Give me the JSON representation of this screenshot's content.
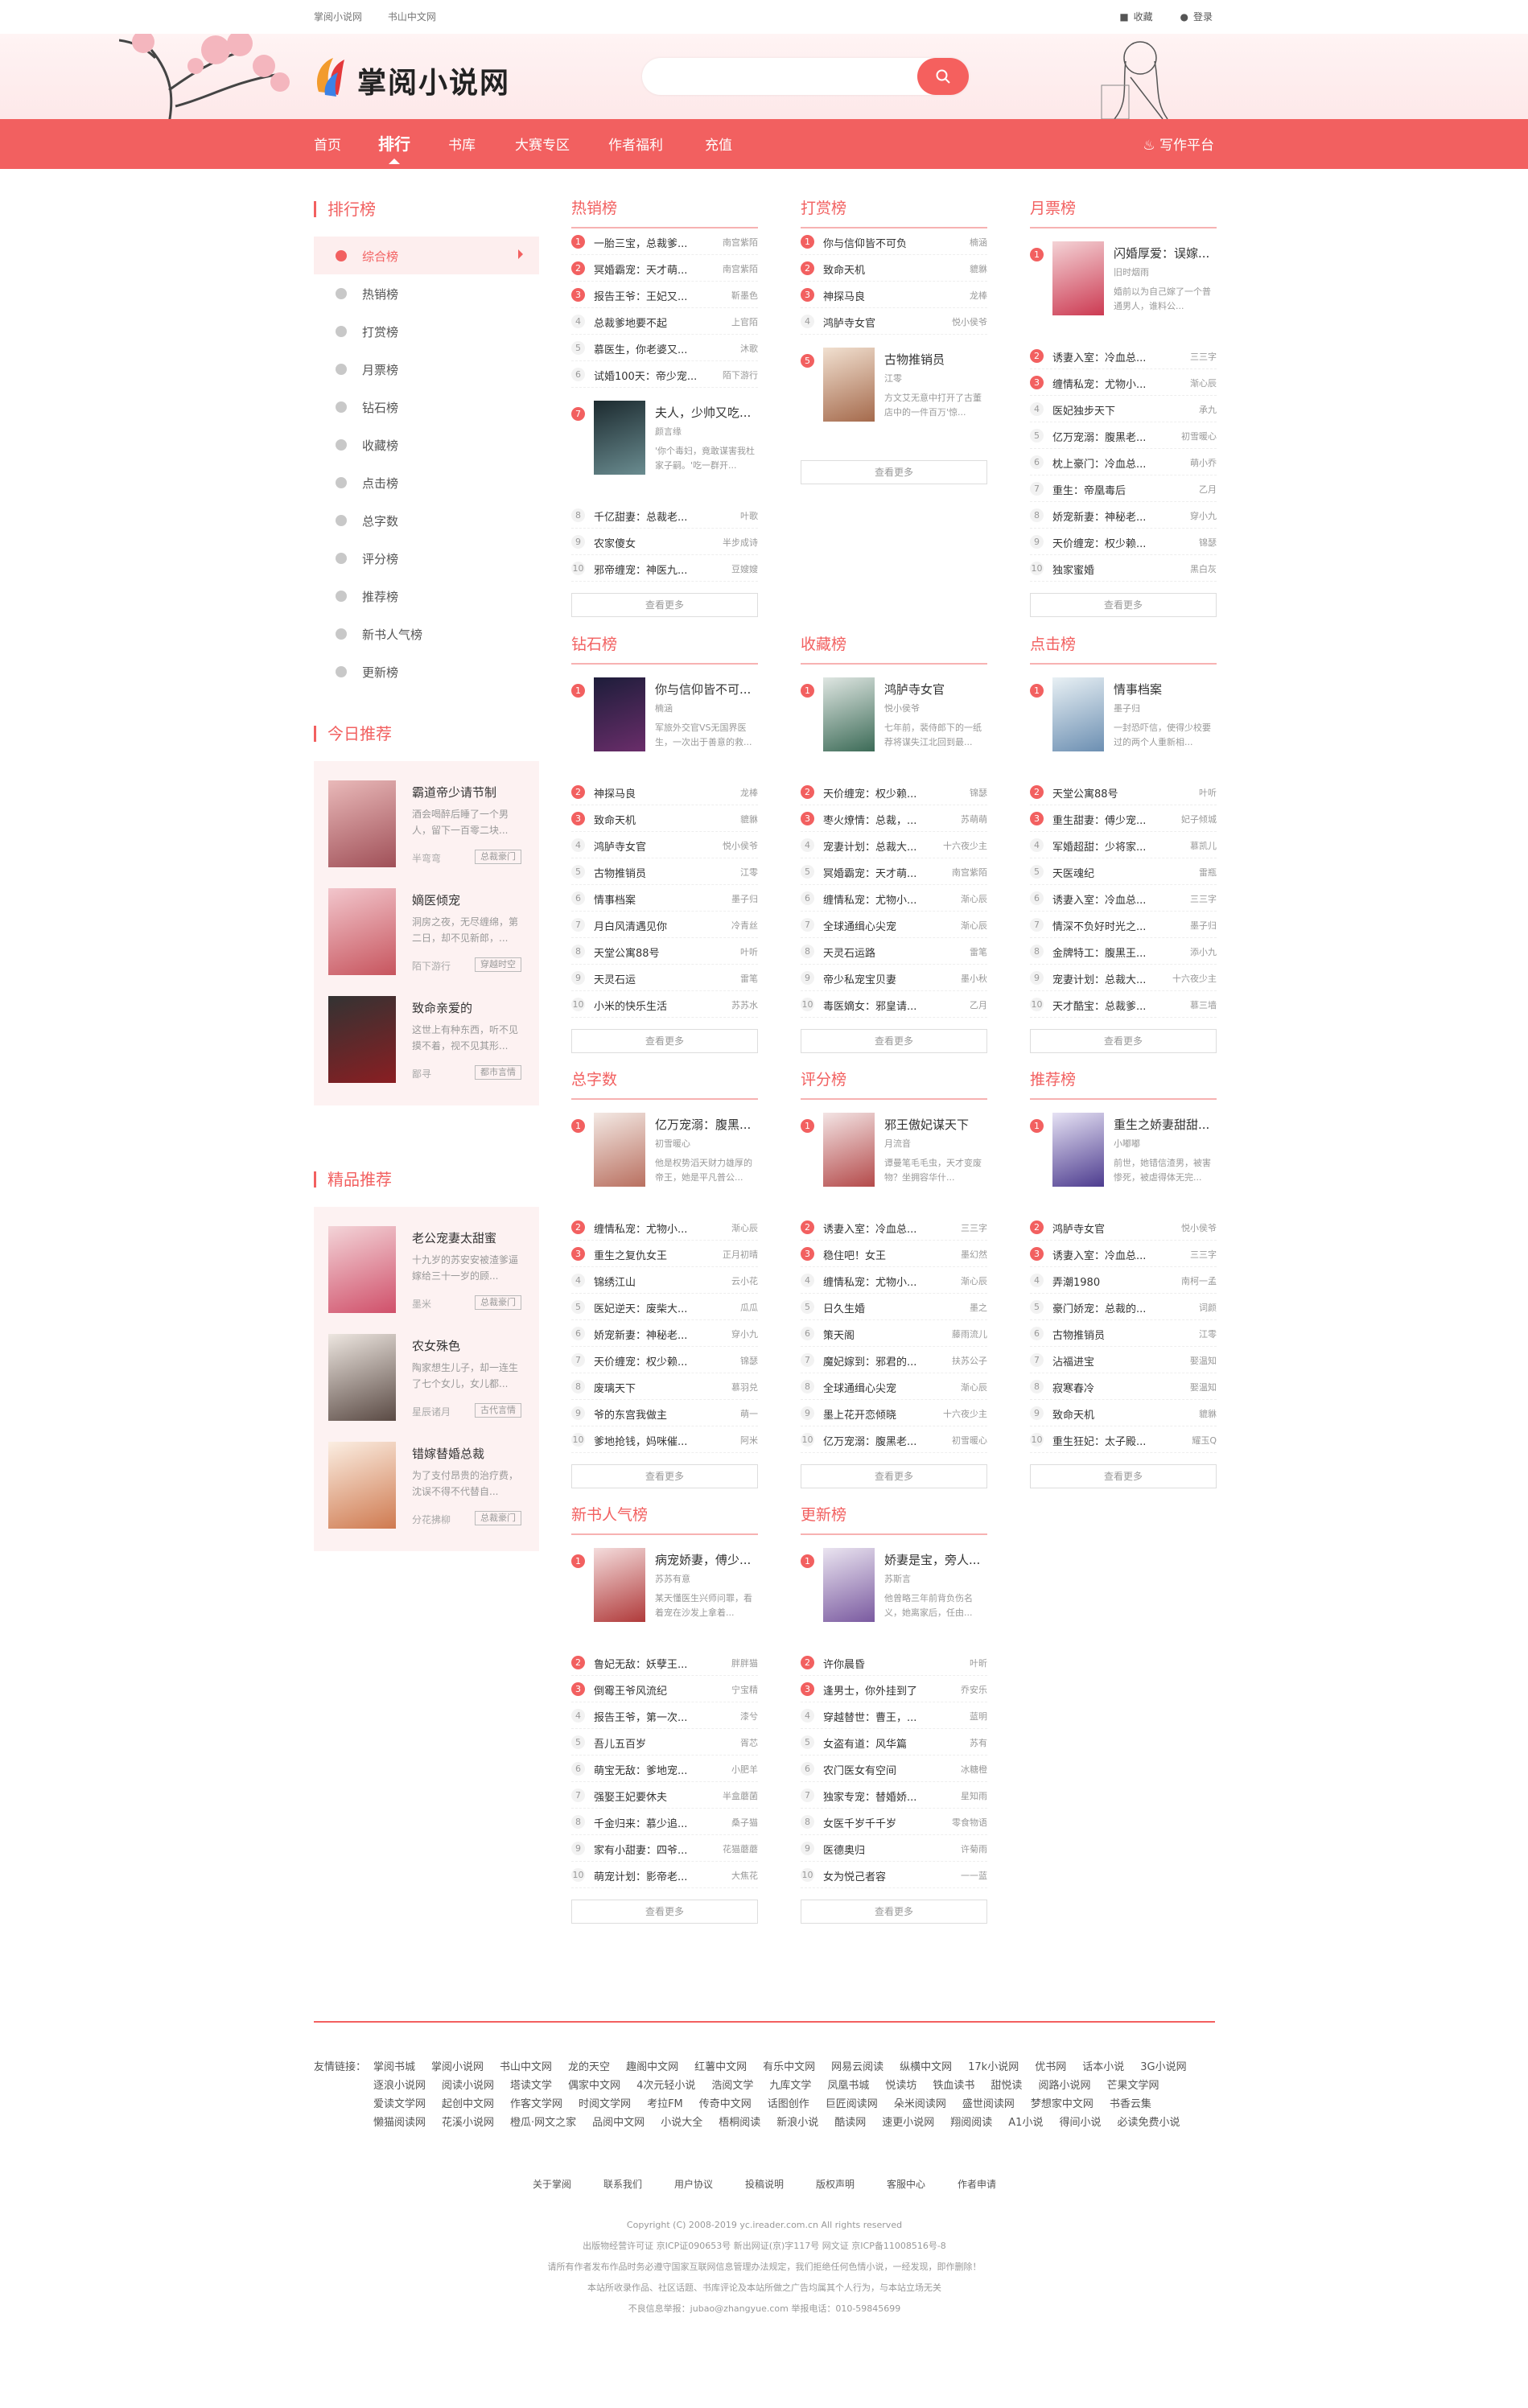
{
  "topbar": {
    "left": [
      "掌阅小说网",
      "书山中文网"
    ],
    "right": [
      "收藏",
      "登录"
    ]
  },
  "logo": {
    "text": "掌阅小说网"
  },
  "search": {
    "placeholder": ""
  },
  "nav": [
    "首页",
    "排行",
    "书库",
    "大赛专区",
    "作者福利",
    "充值"
  ],
  "nav_active": 1,
  "nav_write": "写作平台",
  "colors": {
    "accent": "#f26060"
  },
  "side": {
    "rank_title": "排行榜",
    "ranks": [
      {
        "label": "综合榜",
        "icon": "rank-icon"
      },
      {
        "label": "热销榜",
        "icon": "fire-icon"
      },
      {
        "label": "打赏榜",
        "icon": "gift-icon"
      },
      {
        "label": "月票榜",
        "icon": "ticket-icon"
      },
      {
        "label": "钻石榜",
        "icon": "diamond-icon"
      },
      {
        "label": "收藏榜",
        "icon": "bookmark-icon"
      },
      {
        "label": "点击榜",
        "icon": "click-icon"
      },
      {
        "label": "总字数",
        "icon": "clock-icon"
      },
      {
        "label": "评分榜",
        "icon": "thumb-icon"
      },
      {
        "label": "推荐榜",
        "icon": "user-icon"
      },
      {
        "label": "新书人气榜",
        "icon": "eye-icon"
      },
      {
        "label": "更新榜",
        "icon": "refresh-icon"
      }
    ],
    "today_title": "今日推荐",
    "today": [
      {
        "title": "霸道帝少请节制",
        "desc": "酒会喝醉后睡了一个男人，留下一百零二块...",
        "author": "半弯弯",
        "tag": "总裁豪门",
        "c1": "#e9b9b9",
        "c2": "#a05058"
      },
      {
        "title": "嫡医倾宠",
        "desc": "洞房之夜，无尽缠绵，第二日，却不见新郎，...",
        "author": "陌下游行",
        "tag": "穿越时空",
        "c1": "#f2c6cc",
        "c2": "#c7555e"
      },
      {
        "title": "致命亲爱的",
        "desc": "这世上有种东西，听不见摸不着，视不见其形...",
        "author": "鄙寻",
        "tag": "都市言情",
        "c1": "#333",
        "c2": "#8a1e22"
      }
    ],
    "pick_title": "精品推荐",
    "pick": [
      {
        "title": "老公宠妻太甜蜜",
        "desc": "十九岁的苏安安被渣爹逼嫁给三十一岁的顾...",
        "author": "墨米",
        "tag": "总裁豪门",
        "c1": "#f3d4d8",
        "c2": "#d0506a"
      },
      {
        "title": "农女殊色",
        "desc": "陶家想生儿子，却一连生了七个女儿，女儿都...",
        "author": "星辰诸月",
        "tag": "古代言情",
        "c1": "#ede6e0",
        "c2": "#5a4a44"
      },
      {
        "title": "错嫁替婚总裁",
        "desc": "为了支付昂贵的治疗费，沈误不得不代替自...",
        "author": "分花拂柳",
        "tag": "总裁豪门",
        "c1": "#fbeee2",
        "c2": "#cf7a50"
      }
    ]
  },
  "boards": [
    {
      "title": "热销榜",
      "feature_at": 6,
      "items": [
        {
          "t": "一胎三宝，总裁爹...",
          "a": "南宫紫陌"
        },
        {
          "t": "冥婚霸宠：天才萌...",
          "a": "南宫紫陌"
        },
        {
          "t": "报告王爷：王妃又...",
          "a": "靳墨色"
        },
        {
          "t": "总裁爹地要不起",
          "a": "上官陌"
        },
        {
          "t": "慕医生，你老婆又...",
          "a": "沐歌"
        },
        {
          "t": "试婚100天：帝少宠...",
          "a": "陌下游行"
        },
        {
          "t": "夫人，少帅又吃...",
          "a": "颜言缘",
          "d": "'你个毒妇，竟敢谋害我杜家子嗣。'吃一群开...",
          "c1": "#1c2a2f",
          "c2": "#6a8c90"
        },
        {
          "t": "千亿甜妻：总裁老...",
          "a": "叶歌"
        },
        {
          "t": "农家傻女",
          "a": "半步成诗"
        },
        {
          "t": "邪帝缠宠：神医九...",
          "a": "豆嫂嫂"
        }
      ],
      "more": "查看更多"
    },
    {
      "title": "打赏榜",
      "feature_at": 4,
      "items": [
        {
          "t": "你与信仰皆不可负",
          "a": "楠涵"
        },
        {
          "t": "致命天机",
          "a": "貔貅"
        },
        {
          "t": "神探马良",
          "a": "龙棒"
        },
        {
          "t": "鸿胪寺女官",
          "a": "悦小侯爷"
        },
        {
          "t": "古物推销员",
          "a": "江零",
          "d": "方文艾无意中打开了古董店中的一件百万'惊...",
          "c1": "#f1e0d0",
          "c2": "#a56a4c"
        }
      ],
      "more": "查看更多"
    },
    {
      "title": "月票榜",
      "feature_at": 0,
      "items": [
        {
          "t": "闪婚厚爱：误嫁...",
          "a": "旧时烟雨",
          "d": "婚前以为自己嫁了一个普通男人，谁料公...",
          "c1": "#f4d3d6",
          "c2": "#cc3a52"
        },
        {
          "t": "诱妻入室：冷血总...",
          "a": "三三字"
        },
        {
          "t": "缠情私宠：尤物小...",
          "a": "渐心辰"
        },
        {
          "t": "医妃独步天下",
          "a": "承九"
        },
        {
          "t": "亿万宠溺：腹黑老...",
          "a": "初雪暖心"
        },
        {
          "t": "枕上豪门：冷血总...",
          "a": "萌小乔"
        },
        {
          "t": "重生：帝凰毒后",
          "a": "乙月"
        },
        {
          "t": "娇宠新妻：神秘老...",
          "a": "穿小九"
        },
        {
          "t": "天价缠宠：权少赖...",
          "a": "锦瑟"
        },
        {
          "t": "独家蜜婚",
          "a": "黑白灰"
        }
      ],
      "more": "查看更多"
    },
    {
      "title": "钻石榜",
      "feature_at": 0,
      "items": [
        {
          "t": "你与信仰皆不可...",
          "a": "楠涵",
          "d": "军旅外交官VS无国界医生，一次出于善意的救...",
          "c1": "#1d1d3a",
          "c2": "#6a2d6a"
        },
        {
          "t": "神探马良",
          "a": "龙棒"
        },
        {
          "t": "致命天机",
          "a": "貔貅"
        },
        {
          "t": "鸿胪寺女官",
          "a": "悦小侯爷"
        },
        {
          "t": "古物推销员",
          "a": "江零"
        },
        {
          "t": "情事档案",
          "a": "墨子归"
        },
        {
          "t": "月白风清遇见你",
          "a": "冷青丝"
        },
        {
          "t": "天堂公寓88号",
          "a": "叶听"
        },
        {
          "t": "天灵石运",
          "a": "雷笔"
        },
        {
          "t": "小米的快乐生活",
          "a": "苏苏水"
        }
      ],
      "more": "查看更多"
    },
    {
      "title": "收藏榜",
      "feature_at": 0,
      "items": [
        {
          "t": "鸿胪寺女官",
          "a": "悦小侯爷",
          "d": "七年前，裴侍郎下的一纸荐将谋失江北回到最...",
          "c1": "#dfe6e2",
          "c2": "#3c6b57"
        },
        {
          "t": "天价缠宠：权少赖...",
          "a": "锦瑟"
        },
        {
          "t": "枣火燎情：总裁，...",
          "a": "苏萌萌"
        },
        {
          "t": "宠妻计划：总裁大...",
          "a": "十六夜少主"
        },
        {
          "t": "冥婚霸宠：天才萌...",
          "a": "南宫紫陌"
        },
        {
          "t": "缠情私宠：尤物小...",
          "a": "渐心辰"
        },
        {
          "t": "全球通缉心尖宠",
          "a": "渐心辰"
        },
        {
          "t": "天灵石运路",
          "a": "雷笔"
        },
        {
          "t": "帝少私宠宝贝妻",
          "a": "墨小秋"
        },
        {
          "t": "毒医嫡女：邪皇请...",
          "a": "乙月"
        }
      ],
      "more": "查看更多"
    },
    {
      "title": "点击榜",
      "feature_at": 0,
      "items": [
        {
          "t": "情事档案",
          "a": "墨子归",
          "d": "一封恐吓信，使得少校要过的两个人重新相...",
          "c1": "#e8f0f4",
          "c2": "#6c8fb2"
        },
        {
          "t": "天堂公寓88号",
          "a": "叶听"
        },
        {
          "t": "重生甜妻：傅少宠...",
          "a": "妃子倾城"
        },
        {
          "t": "军婚超甜：少将家...",
          "a": "慕凯儿"
        },
        {
          "t": "天医魂纪",
          "a": "雷瓶"
        },
        {
          "t": "诱妻入室：冷血总...",
          "a": "三三字"
        },
        {
          "t": "情深不负好时光之...",
          "a": "墨子归"
        },
        {
          "t": "金牌特工：腹黑王...",
          "a": "添小九"
        },
        {
          "t": "宠妻计划：总裁大...",
          "a": "十六夜少主"
        },
        {
          "t": "天才酷宝：总裁爹...",
          "a": "慕三墙"
        }
      ],
      "more": "查看更多"
    },
    {
      "title": "总字数",
      "feature_at": 0,
      "items": [
        {
          "t": "亿万宠溺：腹黑...",
          "a": "初雪暖心",
          "d": "他是权势滔天财力雄厚的帝王，她是平凡普公...",
          "c1": "#f3e9e4",
          "c2": "#b97060"
        },
        {
          "t": "缠情私宠：尤物小...",
          "a": "渐心辰"
        },
        {
          "t": "重生之复仇女王",
          "a": "正月初晴"
        },
        {
          "t": "锦绣江山",
          "a": "云小花"
        },
        {
          "t": "医妃逆天：废柴大...",
          "a": "瓜瓜"
        },
        {
          "t": "娇宠新妻：神秘老...",
          "a": "穿小九"
        },
        {
          "t": "天价缠宠：权少赖...",
          "a": "锦瑟"
        },
        {
          "t": "废璃天下",
          "a": "慕羽兑"
        },
        {
          "t": "爷的东宫我做主",
          "a": "萌一"
        },
        {
          "t": "爹地抢钱，妈咪催...",
          "a": "阿米"
        }
      ],
      "more": "查看更多"
    },
    {
      "title": "评分榜",
      "feature_at": 0,
      "items": [
        {
          "t": "邪王傲妃谋天下",
          "a": "月流音",
          "d": "谭曼笔毛毛虫，天才变废物？坐拥容华什...",
          "c1": "#f3e4e4",
          "c2": "#b44a4a"
        },
        {
          "t": "诱妻入室：冷血总...",
          "a": "三三字"
        },
        {
          "t": "稳住吧！女王",
          "a": "墨幻然"
        },
        {
          "t": "缠情私宠：尤物小...",
          "a": "渐心辰"
        },
        {
          "t": "日久生婚",
          "a": "墨之"
        },
        {
          "t": "策天阁",
          "a": "藤雨流儿"
        },
        {
          "t": "魔妃嫁到：邪君的...",
          "a": "扶苏公子"
        },
        {
          "t": "全球通缉心尖宠",
          "a": "渐心辰"
        },
        {
          "t": "墨上花开恋倾晓",
          "a": "十六夜少主"
        },
        {
          "t": "亿万宠溺：腹黑老...",
          "a": "初雪暖心"
        }
      ],
      "more": "查看更多"
    },
    {
      "title": "推荐榜",
      "feature_at": 0,
      "items": [
        {
          "t": "重生之娇妻甜甜...",
          "a": "小嘟嘟",
          "d": "前世，她错信渣男，被害惨死，被虐得体无完...",
          "c1": "#e6e2f4",
          "c2": "#4d3c8f"
        },
        {
          "t": "鸿胪寺女官",
          "a": "悦小侯爷"
        },
        {
          "t": "诱妻入室：冷血总...",
          "a": "三三字"
        },
        {
          "t": "弄潮1980",
          "a": "南柯一孟"
        },
        {
          "t": "豪门娇宠：总裁的...",
          "a": "词颜"
        },
        {
          "t": "古物推销员",
          "a": "江零"
        },
        {
          "t": "沾福进宝",
          "a": "娶温知"
        },
        {
          "t": "寂寒春冷",
          "a": "娶温知"
        },
        {
          "t": "致命天机",
          "a": "貔貅"
        },
        {
          "t": "重生狂妃：太子殿...",
          "a": "耀玉Q"
        }
      ],
      "more": "查看更多"
    },
    {
      "title": "新书人气榜",
      "feature_at": 0,
      "items": [
        {
          "t": "病宠娇妻，傅少...",
          "a": "苏苏有意",
          "d": "某天懂医生兴师问罪，看着宠在沙发上拿着...",
          "c1": "#f4dcdc",
          "c2": "#b03a3a"
        },
        {
          "t": "鲁妃无敌：妖孽王...",
          "a": "胖胖猫"
        },
        {
          "t": "倒霉王爷风流纪",
          "a": "宁宝精"
        },
        {
          "t": "报告王爷，第一次...",
          "a": "漆兮"
        },
        {
          "t": "吾儿五百岁",
          "a": "胥芯"
        },
        {
          "t": "萌宝无敌：爹地宠...",
          "a": "小肥羊"
        },
        {
          "t": "强娶王妃要休夫",
          "a": "半盒蘑菌"
        },
        {
          "t": "千金归来：慕少追...",
          "a": "桑子猫"
        },
        {
          "t": "家有小甜妻：四爷...",
          "a": "花猫蘑蘑"
        },
        {
          "t": "萌宠计划：影帝老...",
          "a": "大焦花"
        }
      ],
      "more": "查看更多"
    },
    {
      "title": "更新榜",
      "feature_at": 0,
      "items": [
        {
          "t": "娇妻是宝，旁人...",
          "a": "苏斯言",
          "d": "他曾略三年前背负伤名义，她离家后，任由...",
          "c1": "#eae4f0",
          "c2": "#7a5aa0"
        },
        {
          "t": "许你晨昏",
          "a": "叶昕"
        },
        {
          "t": "逢男士，你外挂到了",
          "a": "乔安乐"
        },
        {
          "t": "穿越替世：曹王，...",
          "a": "蓝明"
        },
        {
          "t": "女盗有道：风华篇",
          "a": "苏有"
        },
        {
          "t": "农门医女有空间",
          "a": "冰糖橙"
        },
        {
          "t": "独家专宠：替婚娇...",
          "a": "星知雨"
        },
        {
          "t": "女医千岁千千岁",
          "a": "零食物语"
        },
        {
          "t": "医德奥归",
          "a": "许菊雨"
        },
        {
          "t": "女为悦己者容",
          "a": "一一蓝"
        }
      ],
      "more": "查看更多"
    }
  ],
  "footer": {
    "links_label": "友情链接：",
    "links": [
      "掌阅书城",
      "掌阅小说网",
      "书山中文网",
      "龙的天空",
      "趣阁中文网",
      "红薯中文网",
      "有乐中文网",
      "网易云阅读",
      "纵横中文网",
      "17k小说网",
      "优书网",
      "话本小说",
      "3G小说网",
      "逐浪小说网",
      "阅读小说网",
      "塔读文学",
      "偶家中文网",
      "4次元轻小说",
      "浩阅文学",
      "九库文学",
      "凤凰书城",
      "悦读坊",
      "铁血读书",
      "甜悦读",
      "阅路小说网",
      "芒果文学网",
      "爱读文学网",
      "起创中文网",
      "作客文学网",
      "时阅文学网",
      "考拉FM",
      "传奇中文网",
      "话图创作",
      "巨匠阅读网",
      "朵米阅读网",
      "盛世阅读网",
      "梦想家中文网",
      "书香云集",
      "懒猫阅读网",
      "花溪小说网",
      "橙瓜·网文之家",
      "品阅中文网",
      "小说大全",
      "梧桐阅读",
      "新浪小说",
      "酷读网",
      "速更小说网",
      "翔阅阅读",
      "A1小说",
      "得间小说",
      "必读免费小说"
    ],
    "nav": [
      "关于掌阅",
      "联系我们",
      "用户协议",
      "投稿说明",
      "版权声明",
      "客服中心",
      "作者申请"
    ],
    "copy": [
      "Copyright (C) 2008-2019 yc.ireader.com.cn All rights reserved",
      "出版物经营许可证 京ICP证090653号 新出网证(京)字117号 网文证 京ICP备11008516号-8",
      "请所有作者发布作品时务必遵守国家互联网信息管理办法规定，我们拒绝任何色情小说，一经发现，即作删除！",
      "本站所收录作品、社区话题、书库评论及本站所做之广告均属其个人行为，与本站立场无关",
      "不良信息举报：jubao@zhangyue.com 举报电话：010-59845699"
    ]
  }
}
